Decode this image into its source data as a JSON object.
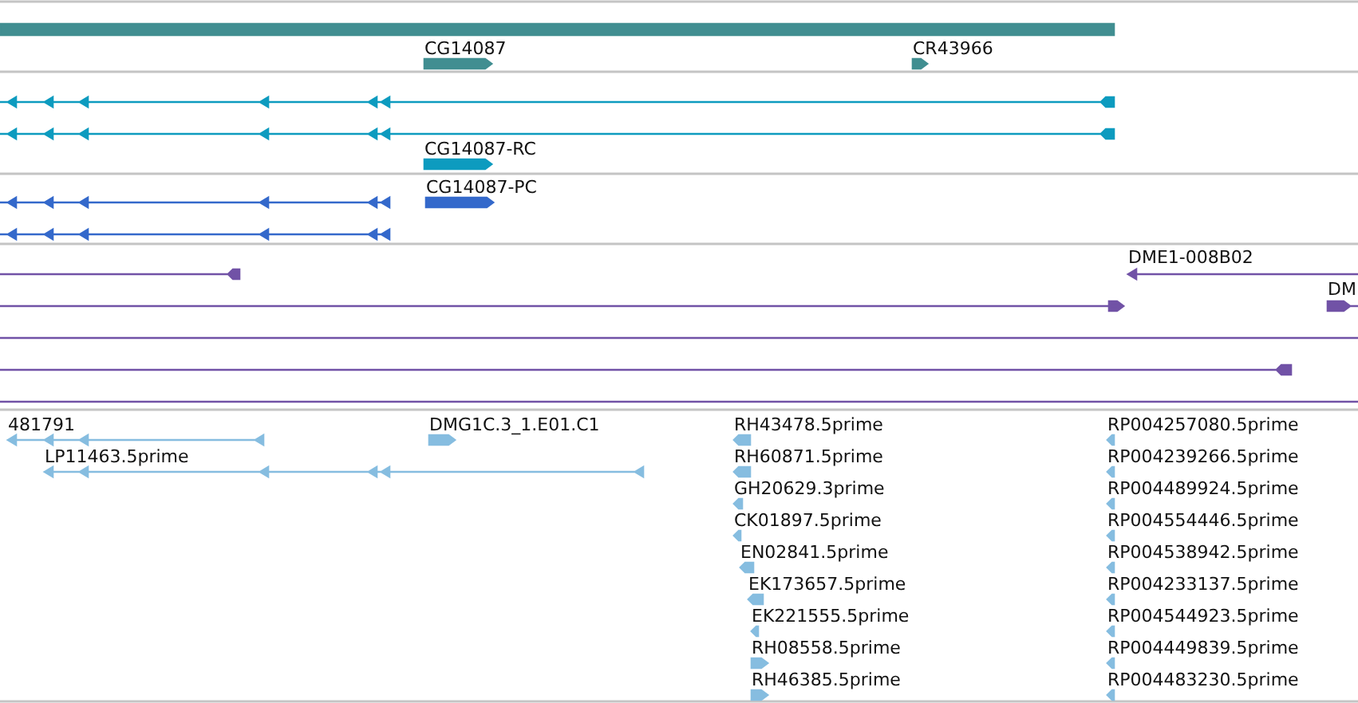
{
  "tracks": [
    {
      "kind": "gene",
      "labels": [
        "CG14087",
        "CR43966"
      ]
    },
    {
      "kind": "transcript",
      "labels": [
        "CG14087-RC"
      ]
    },
    {
      "kind": "protein",
      "labels": [
        "CG14087-PC"
      ]
    },
    {
      "kind": "clone",
      "labels": [
        "DME1-008B02",
        "DM"
      ]
    },
    {
      "kind": "est",
      "labels": [
        "481791",
        "DMG1C.3_1.E01.C1",
        "RH43478.5prime",
        "RP004257080.5prime",
        "LP11463.5prime",
        "RH60871.5prime",
        "RP004239266.5prime",
        "GH20629.3prime",
        "RP004489924.5prime",
        "CK01897.5prime",
        "RP004554446.5prime",
        "EN02841.5prime",
        "RP004538942.5prime",
        "EK173657.5prime",
        "RP004233137.5prime",
        "EK221555.5prime",
        "RP004544923.5prime",
        "RH08558.5prime",
        "RP004449839.5prime",
        "RH46385.5prime",
        "RP004483230.5prime"
      ]
    }
  ]
}
